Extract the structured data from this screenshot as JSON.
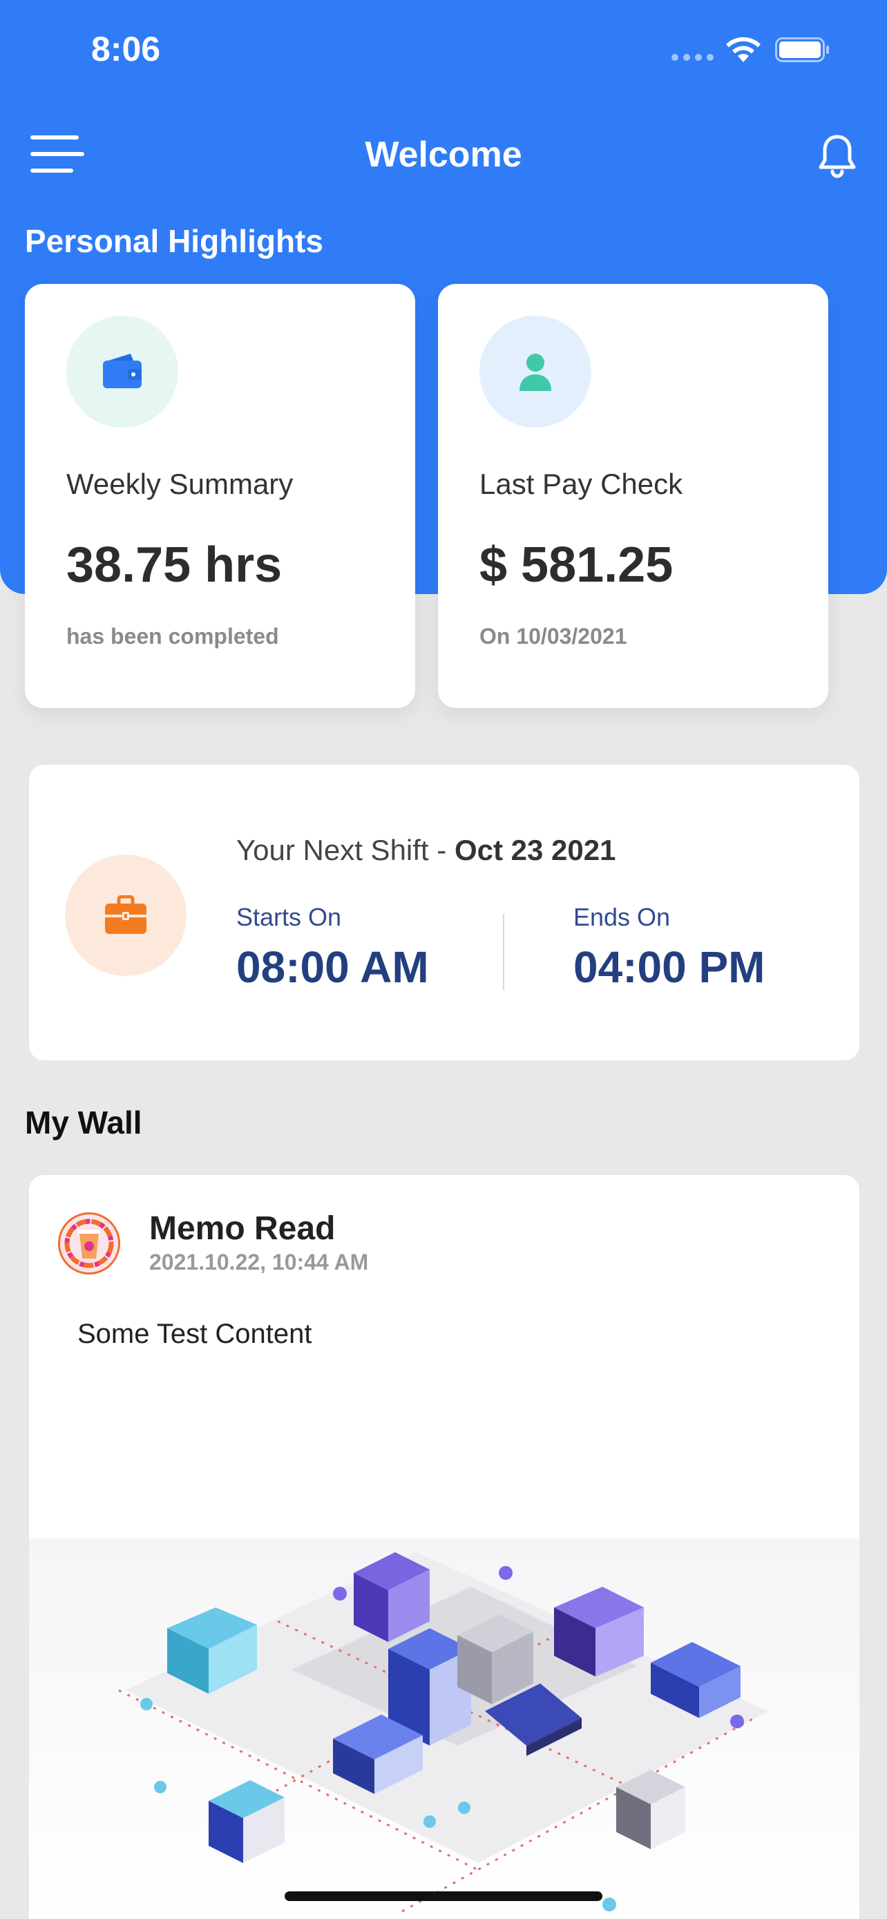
{
  "status_bar": {
    "time": "8:06"
  },
  "navbar": {
    "title": "Welcome",
    "menu_icon": "hamburger-menu-icon",
    "notification_icon": "bell-icon"
  },
  "highlights": {
    "section_title": "Personal Highlights",
    "weekly_summary": {
      "icon": "wallet-icon",
      "label": "Weekly Summary",
      "value": "38.75 hrs",
      "subtext": "has been completed"
    },
    "last_pay_check": {
      "icon": "user-icon",
      "label": "Last Pay Check",
      "value": "$ 581.25",
      "subtext": "On 10/03/2021"
    }
  },
  "next_shift": {
    "icon": "briefcase-icon",
    "title_prefix": "Your Next Shift - ",
    "date": "Oct 23 2021",
    "starts_label": "Starts On",
    "starts_value": "08:00 AM",
    "ends_label": "Ends On",
    "ends_value": "04:00 PM"
  },
  "wall": {
    "section_title": "My Wall",
    "post": {
      "title": "Memo Read",
      "timestamp": "2021.10.22, 10:44 AM",
      "body": "Some Test Content",
      "avatar_icon": "dunkin-logo-icon",
      "image": "isometric-city-illustration"
    }
  },
  "colors": {
    "primary": "#2f7cf6",
    "shift_text": "#233f80",
    "orange": "#f37b20",
    "teal": "#3fc9a8",
    "page_bg": "#e8e8e8"
  }
}
